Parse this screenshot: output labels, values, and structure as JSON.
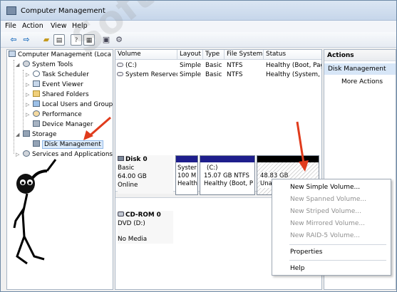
{
  "window": {
    "title": "Computer Management"
  },
  "menu": [
    "File",
    "Action",
    "View",
    "Help"
  ],
  "toolbar": [
    {
      "name": "back-icon",
      "glyph": "⇦"
    },
    {
      "name": "forward-icon",
      "glyph": "⇨"
    },
    {
      "name": "up-folder-icon",
      "glyph": "↥"
    },
    {
      "name": "show-console-tree-icon",
      "glyph": "▤"
    },
    {
      "name": "help-icon",
      "glyph": "?"
    },
    {
      "name": "properties-icon",
      "glyph": "▦"
    },
    {
      "name": "export-icon",
      "glyph": "▣"
    },
    {
      "name": "settings-icon",
      "glyph": "⚙"
    }
  ],
  "tree": {
    "root": "Computer Management (Loca",
    "system_tools": "System Tools",
    "task_scheduler": "Task Scheduler",
    "event_viewer": "Event Viewer",
    "shared_folders": "Shared Folders",
    "local_users": "Local Users and Groups",
    "performance": "Performance",
    "device_manager": "Device Manager",
    "storage": "Storage",
    "disk_management": "Disk Management",
    "services": "Services and Applications"
  },
  "volumes": {
    "headers": [
      "Volume",
      "Layout",
      "Type",
      "File System",
      "Status"
    ],
    "rows": [
      [
        "(C:)",
        "Simple",
        "Basic",
        "NTFS",
        "Healthy (Boot, Pag"
      ],
      [
        "System Reserved",
        "Simple",
        "Basic",
        "NTFS",
        "Healthy (System, A"
      ]
    ]
  },
  "disks": {
    "disk0": {
      "name": "Disk 0",
      "type": "Basic",
      "size": "64.00 GB",
      "state": "Online"
    },
    "cdrom0": {
      "name": "CD-ROM 0",
      "drive": "DVD (D:)",
      "media": "No Media"
    },
    "partitions": {
      "system": {
        "l1": "Syster",
        "l2": "100 M",
        "l3": "Health"
      },
      "c": {
        "l1": "(C:)",
        "l2": "15.07 GB NTFS",
        "l3": "Healthy (Boot, P"
      },
      "unalloc": {
        "l1": "48.83 GB",
        "l2": "Una"
      }
    },
    "colors": {
      "primary_bar": "#1e1e8c",
      "unallocated_bar": "#000000"
    }
  },
  "actions": {
    "header": "Actions",
    "selected": "Disk Management",
    "more": "More Actions"
  },
  "context_menu": {
    "items": [
      {
        "label": "New Simple Volume...",
        "enabled": true
      },
      {
        "label": "New Spanned Volume...",
        "enabled": false
      },
      {
        "label": "New Striped Volume...",
        "enabled": false
      },
      {
        "label": "New Mirrored Volume...",
        "enabled": false
      },
      {
        "label": "New RAID-5 Volume...",
        "enabled": false
      },
      {
        "label": "Properties",
        "enabled": true
      },
      {
        "label": "Help",
        "enabled": true
      }
    ]
  },
  "watermark": "SoftwareOK.de",
  "accent_color": "#e03b1c"
}
